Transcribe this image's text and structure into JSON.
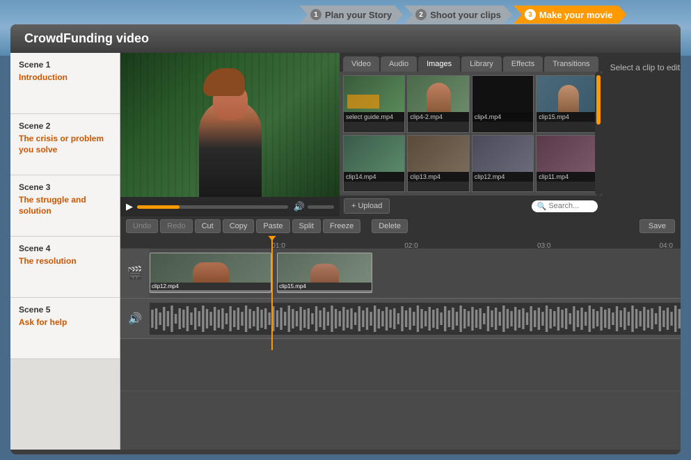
{
  "app": {
    "title": "CrowdFunding video"
  },
  "steps": [
    {
      "num": "1",
      "label": "Plan your Story",
      "state": "inactive"
    },
    {
      "num": "2",
      "label": "Shoot your clips",
      "state": "inactive"
    },
    {
      "num": "3",
      "label": "Make your movie",
      "state": "active"
    }
  ],
  "scenes": [
    {
      "id": "scene1",
      "label": "Scene 1",
      "desc": "Introduction"
    },
    {
      "id": "scene2",
      "label": "Scene 2",
      "desc": "The crisis or problem you solve"
    },
    {
      "id": "scene3",
      "label": "Scene 3",
      "desc": "The struggle and solution"
    },
    {
      "id": "scene4",
      "label": "Scene 4",
      "desc": "The resolution"
    },
    {
      "id": "scene5",
      "label": "Scene 5",
      "desc": "Ask for help"
    }
  ],
  "media_tabs": [
    {
      "id": "video",
      "label": "Video",
      "active": false
    },
    {
      "id": "audio",
      "label": "Audio",
      "active": false
    },
    {
      "id": "images",
      "label": "Images",
      "active": true
    },
    {
      "id": "library",
      "label": "Library",
      "active": false
    },
    {
      "id": "effects",
      "label": "Effects",
      "active": false
    },
    {
      "id": "transitions",
      "label": "Transitions",
      "active": false
    }
  ],
  "media_files": [
    {
      "name": "select guide.mp4",
      "bg": "thumb-bg-1"
    },
    {
      "name": "clip4-2.mp4",
      "bg": "thumb-bg-2"
    },
    {
      "name": "clip4.mp4",
      "bg": "thumb-bg-3"
    },
    {
      "name": "clip15.mp4",
      "bg": "thumb-bg-4"
    },
    {
      "name": "clip14.mp4",
      "bg": "thumb-bg-5"
    },
    {
      "name": "clip13.mp4",
      "bg": "thumb-bg-6"
    },
    {
      "name": "clip12.mp4",
      "bg": "thumb-bg-7"
    },
    {
      "name": "clip11.mp4",
      "bg": "thumb-bg-8"
    }
  ],
  "toolbar": {
    "undo": "Undo",
    "redo": "Redo",
    "cut": "Cut",
    "copy": "Copy",
    "paste": "Paste",
    "split": "Split",
    "freeze": "Freeze",
    "delete": "Delete",
    "save": "Save"
  },
  "timeline": {
    "ruler_marks": [
      "01:0",
      "02:0",
      "03:0",
      "04:0"
    ],
    "clips": [
      {
        "name": "clip12.mp4",
        "start_pct": 0,
        "width_pct": 25
      },
      {
        "name": "clip15.mp4",
        "start_pct": 26,
        "width_pct": 20
      }
    ]
  },
  "properties": {
    "label": "Select a clip to edit properties"
  },
  "upload_btn": "+ Upload",
  "search_placeholder": "Search..."
}
